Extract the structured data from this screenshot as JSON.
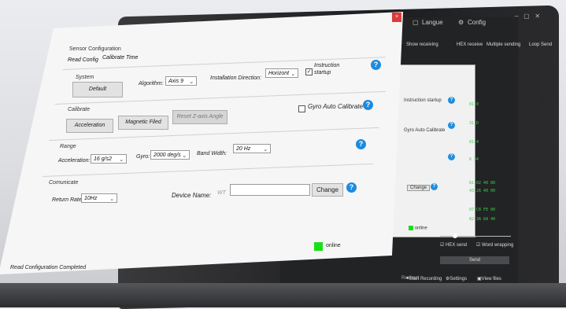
{
  "background": {
    "top_bar": {
      "langue": "Langue",
      "config": "Config"
    },
    "toolbar": {
      "show_receiving": "Show receiving",
      "hex_receive": "HEX receive",
      "multiple_sending": "Multiple sending",
      "loop_send": "Loop Send"
    },
    "panel": {
      "instruction_startup": "Instruction startup",
      "gyro_auto_calibrate": "Gyro Auto Calibrate",
      "change": "Change",
      "online": "online"
    },
    "bottom": {
      "hex_send": "HEX send",
      "word_wrapping": "Word wrapping",
      "send": "Send"
    },
    "status": {
      "start_recording": "Start Recording",
      "settings": "Settings",
      "view_files": "View files",
      "redirect": "Redirect"
    }
  },
  "dialog": {
    "title": "Sensor Configuration",
    "menu": [
      "Read Config",
      "Calibrate Time"
    ],
    "system": {
      "section": "System",
      "default_button": "Default",
      "algorithm_label": "Algorithm:",
      "algorithm_value": "Axis 9",
      "installation_label": "Installation Direction:",
      "installation_value": "Horizont",
      "instruction_startup": "Instruction startup",
      "instruction_checked": true
    },
    "calibrate": {
      "section": "Calibrate",
      "acceleration_button": "Acceleration",
      "magnetic_button": "Magnetic Filed",
      "reset_button": "Reset Z-axis Angle",
      "gyro_auto_calibrate": "Gyro Auto Calibrate"
    },
    "range": {
      "section": "Range",
      "acceleration_label": "Acceleration:",
      "acceleration_value": "16 g/s2",
      "gyro_label": "Gyro:",
      "gyro_value": "2000 deg/s",
      "bandwidth_label": "Band Width:",
      "bandwidth_value": "20 Hz"
    },
    "communicate": {
      "section": "Comunicate",
      "return_rate_label": "Return Rate:",
      "return_rate_value": "10Hz",
      "device_name_label": "Device Name:",
      "device_name_prefix": "WT",
      "device_name_value": "",
      "change_button": "Change"
    },
    "status_online": "online",
    "status_message": "Read Configuration Completed",
    "close": "×",
    "help": "?"
  }
}
